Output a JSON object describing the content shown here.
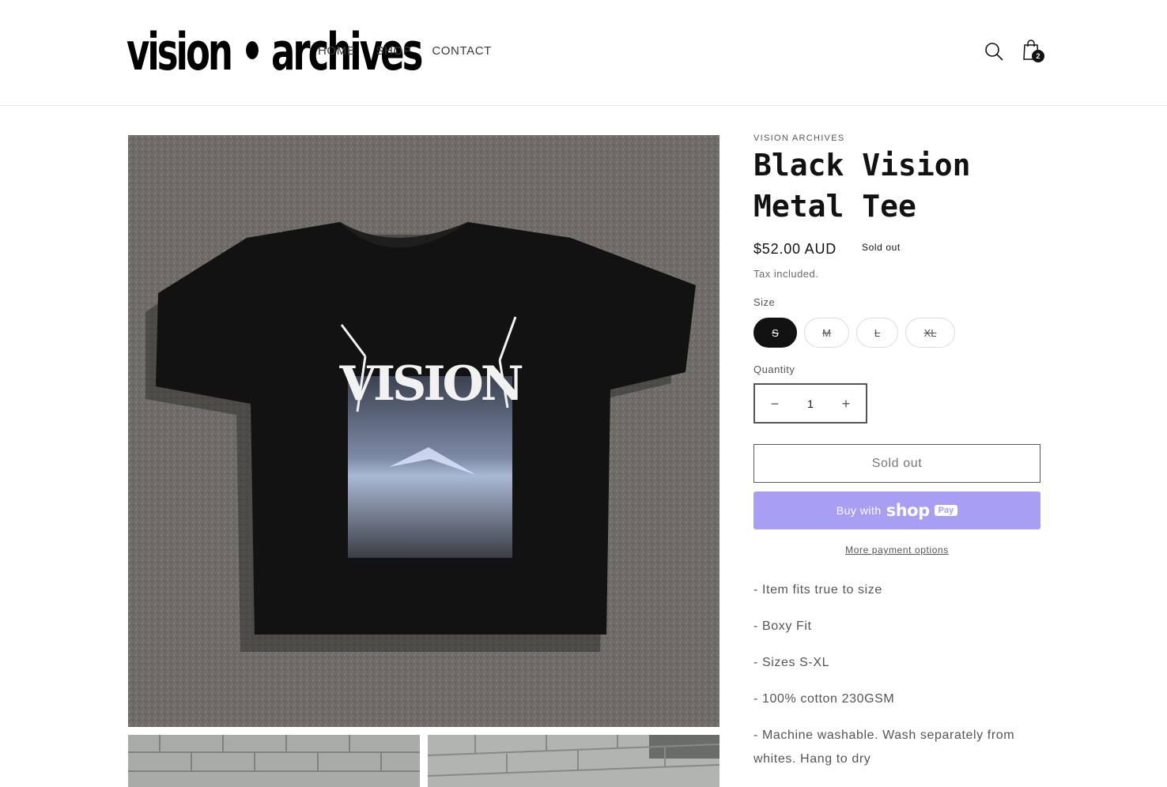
{
  "header": {
    "logo_text": "vision • archives",
    "nav": [
      "HOME",
      "SHOP",
      "CONTACT"
    ],
    "icons": {
      "search": "search-icon",
      "cart": "cart-bag-icon"
    },
    "cart_count": "2"
  },
  "gallery": {
    "main_image": "black-tee-on-asphalt",
    "print_text": "VISION",
    "thumbnails": [
      "brick-wall-photo",
      "brick-wall-photo"
    ]
  },
  "product": {
    "vendor": "VISION ARCHIVES",
    "title": "Black Vision Metal Tee",
    "price": "$52.00 AUD",
    "badge": "Sold out",
    "tax_note": "Tax included.",
    "size_label": "Size",
    "sizes": [
      {
        "label": "S",
        "selected": true,
        "available": false
      },
      {
        "label": "M",
        "selected": false,
        "available": false
      },
      {
        "label": "L",
        "selected": false,
        "available": false
      },
      {
        "label": "XL",
        "selected": false,
        "available": false
      }
    ],
    "quantity_label": "Quantity",
    "quantity_value": "1",
    "decrease_symbol": "−",
    "increase_symbol": "+",
    "sold_out_button": "Sold out",
    "shop_pay": {
      "prefix": "Buy with",
      "brand": "shop",
      "chip": "Pay"
    },
    "more_payment": "More payment options",
    "description": [
      "- Item fits true to size",
      "- Boxy Fit",
      "- Sizes S-XL",
      "- 100% cotton 230GSM",
      "- Machine washable. Wash separately from whites. Hang to dry"
    ]
  },
  "colors": {
    "accent": "#121212",
    "shop_pay": "#a89ef3",
    "text_muted": "#555555"
  }
}
